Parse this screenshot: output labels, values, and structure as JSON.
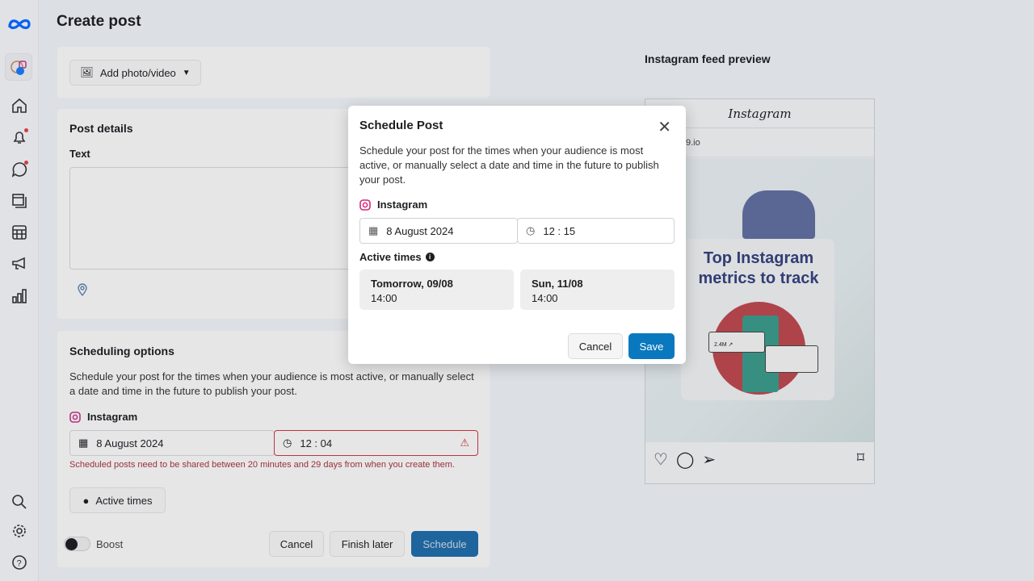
{
  "header": {
    "title": "Create post"
  },
  "sidebar": {
    "items": [
      {
        "icon": "home-icon"
      },
      {
        "icon": "bell-icon",
        "badge": true
      },
      {
        "icon": "chat-icon",
        "badge": true
      },
      {
        "icon": "pages-icon"
      },
      {
        "icon": "calendar-grid-icon"
      },
      {
        "icon": "megaphone-icon"
      },
      {
        "icon": "bar-chart-icon"
      },
      {
        "icon": "search-icon"
      },
      {
        "icon": "gear-icon"
      },
      {
        "icon": "help-icon"
      }
    ]
  },
  "media": {
    "add_label": "Add photo/video"
  },
  "post_details": {
    "title": "Post details",
    "text_label": "Text"
  },
  "scheduling": {
    "title": "Scheduling options",
    "description": "Schedule your post for the times when your audience is most active, or manually select a date and time in the future to publish your post.",
    "platform": "Instagram",
    "date": "8 August 2024",
    "time": "12 : 04",
    "error": "Scheduled posts need to be shared between 20 minutes and 29 days from when you create them.",
    "active_times_label": "Active times"
  },
  "footer": {
    "boost_label": "Boost",
    "boost_on": false,
    "cancel": "Cancel",
    "finish_later": "Finish later",
    "schedule": "Schedule"
  },
  "preview": {
    "title": "Instagram feed preview",
    "app_name": "Instagram",
    "account": "9.io",
    "image_headline": "Top Instagram metrics to track",
    "image_stat": "2.4M ↗"
  },
  "modal": {
    "title": "Schedule Post",
    "description": "Schedule your post for the times when your audience is most active, or manually select a date and time in the future to publish your post.",
    "platform": "Instagram",
    "date": "8 August 2024",
    "time": "12 : 15",
    "active_times_label": "Active times",
    "slots": [
      {
        "day": "Tomorrow, 09/08",
        "time": "14:00"
      },
      {
        "day": "Sun, 11/08",
        "time": "14:00"
      }
    ],
    "cancel": "Cancel",
    "save": "Save"
  },
  "colors": {
    "primary": "#0a78be",
    "error": "#c8373f",
    "meta_blue": "#0866ff"
  }
}
